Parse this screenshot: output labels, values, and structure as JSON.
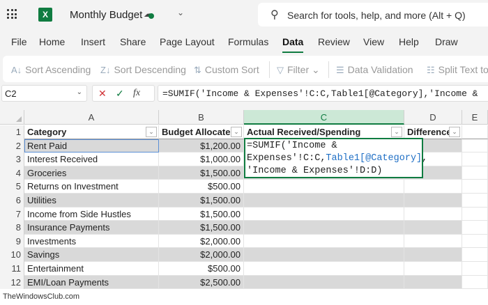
{
  "app": {
    "title": "Monthly Budget",
    "search_placeholder": "Search for tools, help, and more (Alt + Q)",
    "logo": "X"
  },
  "tabs": [
    "File",
    "Home",
    "Insert",
    "Share",
    "Page Layout",
    "Formulas",
    "Data",
    "Review",
    "View",
    "Help",
    "Draw"
  ],
  "active_tab": "Data",
  "ribbon": {
    "sort_asc": "Sort Ascending",
    "sort_desc": "Sort Descending",
    "custom_sort": "Custom Sort",
    "filter": "Filter",
    "data_validation": "Data Validation",
    "split_text": "Split Text to"
  },
  "formula_bar": {
    "name_box": "C2",
    "formula": "=SUMIF('Income & Expenses'!C:C,Table1[@Category],'Income &",
    "fx": "fx"
  },
  "columns": [
    "A",
    "B",
    "C",
    "D",
    "E"
  ],
  "headers": [
    "Category",
    "Budget Allocated",
    "Actual Received/Spending",
    "Difference"
  ],
  "rows": [
    {
      "n": "2",
      "cat": "Rent Paid",
      "budget": "$1,200.00"
    },
    {
      "n": "3",
      "cat": "Interest Received",
      "budget": "$1,000.00"
    },
    {
      "n": "4",
      "cat": "Groceries",
      "budget": "$1,500.00"
    },
    {
      "n": "5",
      "cat": "Returns on Investment",
      "budget": "$500.00"
    },
    {
      "n": "6",
      "cat": "Utilities",
      "budget": "$1,500.00"
    },
    {
      "n": "7",
      "cat": "Income from Side Hustles",
      "budget": "$1,500.00"
    },
    {
      "n": "8",
      "cat": "Insurance Payments",
      "budget": "$1,500.00"
    },
    {
      "n": "9",
      "cat": "Investments",
      "budget": "$2,000.00"
    },
    {
      "n": "10",
      "cat": "Savings",
      "budget": "$2,000.00"
    },
    {
      "n": "11",
      "cat": "Entertainment",
      "budget": "$500.00"
    },
    {
      "n": "12",
      "cat": "EMI/Loan Payments",
      "budget": "$2,500.00"
    }
  ],
  "editor": {
    "p1": "=SUMIF('Income &\nExpenses'!C:C,",
    "ref": "Table1[@Category]",
    "p2": ",\n'Income & Expenses'!D:D)"
  },
  "watermark": "TheWindowsClub.com"
}
